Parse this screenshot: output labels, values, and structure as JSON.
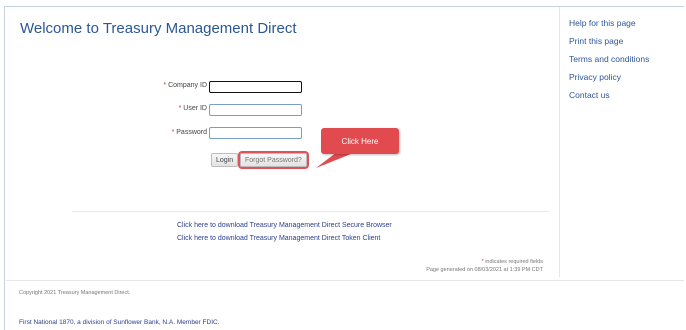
{
  "header": {
    "title": "Welcome to Treasury Management Direct"
  },
  "form": {
    "required_marker": "*",
    "company_id_label": "Company ID",
    "user_id_label": "User ID",
    "password_label": "Password",
    "company_id_value": "",
    "user_id_value": "",
    "password_value": "",
    "login_button": "Login",
    "forgot_password_button": "Forgot Password?"
  },
  "callout": {
    "text": "Click Here",
    "color": "#e14b50"
  },
  "links": {
    "secure_browser": "Click here to download Treasury Management Direct Secure Browser",
    "token_client": "Click here to download Treasury Management Direct Token Client"
  },
  "notes": {
    "required_fields": "indicates required fields",
    "generated": "Page generated on 08/03/2021 at 1:39 PM CDT"
  },
  "sidebar": {
    "items": [
      {
        "label": "Help for this page"
      },
      {
        "label": "Print this page"
      },
      {
        "label": "Terms and conditions"
      },
      {
        "label": "Privacy policy"
      },
      {
        "label": "Contact us"
      }
    ]
  },
  "footer": {
    "copyright": "Copyright 2021 Treasury Management Direct.",
    "member": "First National 1870, a division of Sunflower Bank, N.A. Member FDIC."
  },
  "colors": {
    "title": "#2b5797",
    "link": "#2b3f8c",
    "callout": "#e14b50"
  }
}
